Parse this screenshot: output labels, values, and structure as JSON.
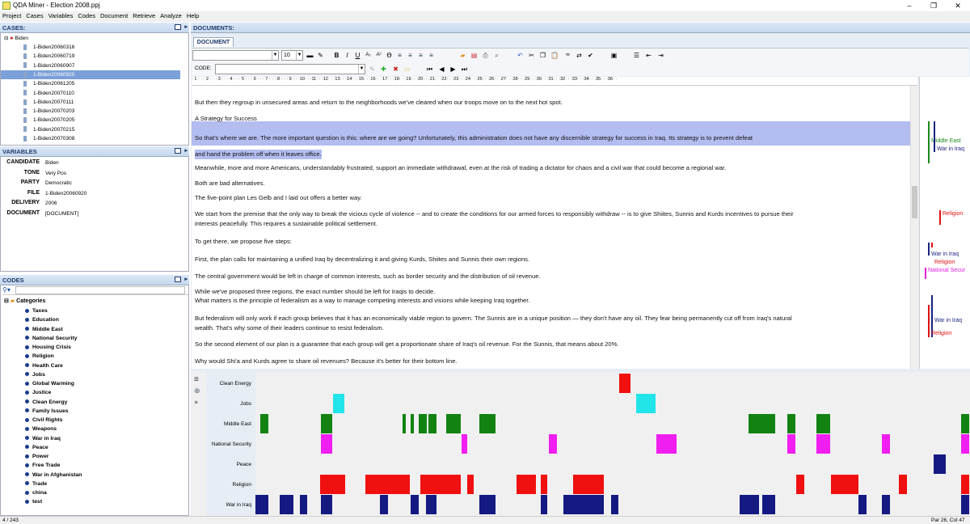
{
  "window": {
    "title": "QDA Miner - Election 2008.ppj",
    "minimize": "–",
    "restore": "❐",
    "close": "✕"
  },
  "menu": [
    "Project",
    "Cases",
    "Variables",
    "Codes",
    "Document",
    "Retrieve",
    "Analyze",
    "Help"
  ],
  "cases_panel": {
    "title": "CASES:",
    "root": "Biden",
    "items": [
      "1-Biden20060316",
      "1-Biden20060719",
      "1-Biden20060907",
      "1-Biden20060920",
      "1-Biden20061205",
      "1-Biden20070110",
      "1-Biden20070111",
      "1-Biden20070203",
      "1-Biden20070205",
      "1-Biden20070215",
      "1-Biden20070308"
    ],
    "selected_index": 3
  },
  "variables_panel": {
    "title": "VARIABLES",
    "rows": [
      {
        "key": "CANDIDATE",
        "value": "Biden"
      },
      {
        "key": "TONE",
        "value": "Very Pos"
      },
      {
        "key": "PARTY",
        "value": "Democratic"
      },
      {
        "key": "FILE",
        "value": "1-Biden20060920"
      },
      {
        "key": "DELIVERY",
        "value": "2006"
      },
      {
        "key": "DOCUMENT",
        "value": "[DOCUMENT]"
      }
    ]
  },
  "codes_panel": {
    "title": "CODES",
    "root": "Categories",
    "items": [
      "Taxes",
      "Education",
      "Middle East",
      "National Security",
      "Housing Crisis",
      "Religion",
      "Health Care",
      "Jobs",
      "Global Warming",
      "Justice",
      "Clean Energy",
      "Family Issues",
      "Civil Rights",
      "Weapons",
      "War in Iraq",
      "Peace",
      "Power",
      "Free Trade",
      "War in Afghanistan",
      "Trade",
      "china",
      "test"
    ]
  },
  "documents": {
    "title": "DOCUMENTS:",
    "tab": "DOCUMENT",
    "font_size": "10",
    "code_label": "CODE:",
    "ruler": "· 1 · · · 2 · · · 3 · · · 4 · · · 5 · · · 6 · · · 7 · · · 8 · · · 9 · · ·10· · ·11· · ·12· · ·13· · ·14· · ·15· · ·16· · ·17· · ·18· · ·19· · ·20· · ·21· · ·22· · ·23· · ·24· · ·25· · ·26· · ·27· · ·28· · ·29· · ·30· · ·31· · ·32· · ·33· · ·34· · ·35· · ·36· ·",
    "paragraphs": [
      "But then they regroup in unsecured areas and return to the neighborhoods we've cleared when our troops move on to the next hot spot.",
      "A Strategy for Success",
      "So that's where we are. The more important question is this: where are we going? Unfortunately, this administration does not have any discernible strategy for success in Iraq. Its strategy is to prevent defeat",
      "and hand the problem off when it leaves office.",
      "Meanwhile, more and more Americans, understandably frustrated, support an immediate withdrawal, even at the risk of trading a dictator for chaos and a civil war that could become a regional war.",
      "Both are bad alternatives.",
      "The five-point plan Les Gelb and I laid out offers a better way.",
      "We start from the premise that the only way to break the vicious cycle of violence -- and to create the conditions for our armed forces to responsibly withdraw -- is to give Shiites, Sunnis and Kurds incentives to pursue their",
      "interests peacefully. This requires a sustainable political settlement.",
      "To get there, we propose five steps:",
      "First, the plan calls for maintaining a unified Iraq by decentralizing it and giving Kurds, Shiites and Sunnis their own regions.",
      "The central government would be left in charge of common interests, such as border security and the distribution of oil revenue.",
      "While we've proposed three regions, the exact number should be left for Iraqis to decide.",
      "What matters is the principle of federalism as a way to manage competing interests and visions while keeping Iraq together.",
      "But federalism will only work if each group believes that it has an economically viable region to govern. The Sunnis are in a unique position — they don't have any oil. They fear being permanently cut off from Iraq's natural",
      "wealth. That's why some of their leaders continue to resist federalism.",
      "So the second element of our plan is a guarantee that each group will get a proportionate share of Iraq's oil revenue. For the Sunnis, that means about 20%.",
      "Why would Shi'a and Kurds agree to share oil revenues? Because it's better for their bottom line."
    ]
  },
  "margin_codes": [
    {
      "label": "Middle East",
      "color": "#1a8a1a"
    },
    {
      "label": "War in Iraq",
      "color": "#1a237e"
    },
    {
      "label": "Religion",
      "color": "#e01010"
    },
    {
      "label": "War in Iraq",
      "color": "#1a237e"
    },
    {
      "label": "Religion",
      "color": "#e01010"
    },
    {
      "label": "National Secur",
      "color": "#e020e0"
    },
    {
      "label": "War in Iraq",
      "color": "#1a237e"
    },
    {
      "label": "Religion",
      "color": "#e01010"
    }
  ],
  "chart": {
    "rows": [
      {
        "name": "Clean Energy",
        "color": "#f01010"
      },
      {
        "name": "Jobs",
        "color": "#22e5ea"
      },
      {
        "name": "Middle East",
        "color": "#128312"
      },
      {
        "name": "National Security",
        "color": "#f01ef0"
      },
      {
        "name": "Peace",
        "color": "#141a82"
      },
      {
        "name": "Religion",
        "color": "#f01010"
      },
      {
        "name": "War in Iraq",
        "color": "#141a82"
      }
    ]
  },
  "status": {
    "left": "4 / 243",
    "right": "Par 26, Col 47"
  }
}
